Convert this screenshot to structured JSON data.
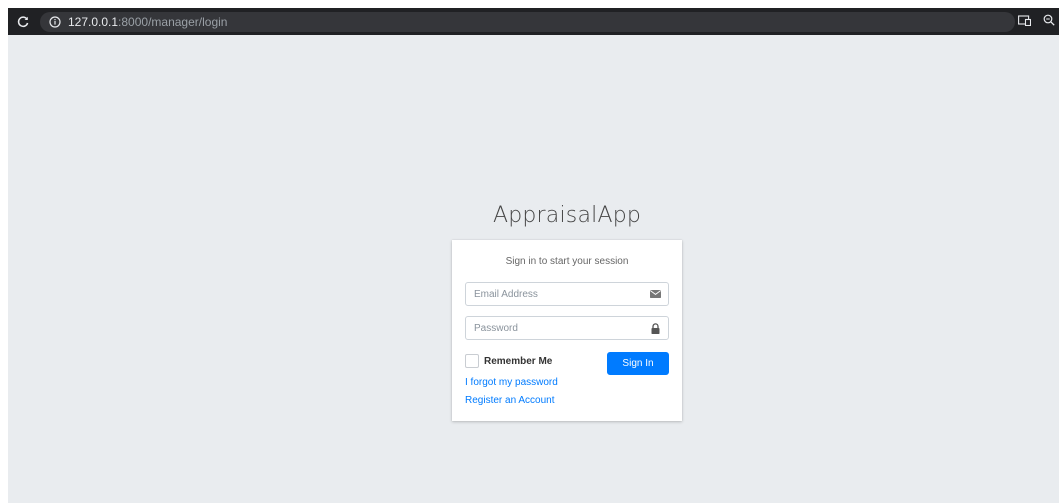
{
  "browser": {
    "url_host": "127.0.0.1",
    "url_rest": ":8000/manager/login",
    "icons": [
      "reload-icon",
      "info-icon",
      "cast-icon",
      "zoom-icon"
    ]
  },
  "app": {
    "title": "AppraisalApp"
  },
  "login": {
    "message": "Sign in to start your session",
    "email_placeholder": "Email Address",
    "email_value": "",
    "password_placeholder": "Password",
    "password_value": "",
    "remember_label": "Remember Me",
    "remember_checked": false,
    "signin_label": "Sign In",
    "forgot_link": "I forgot my password",
    "register_link": "Register an Account"
  },
  "colors": {
    "page_bg": "#e9ecef",
    "primary": "#007bff",
    "browser_bar": "#202124"
  }
}
